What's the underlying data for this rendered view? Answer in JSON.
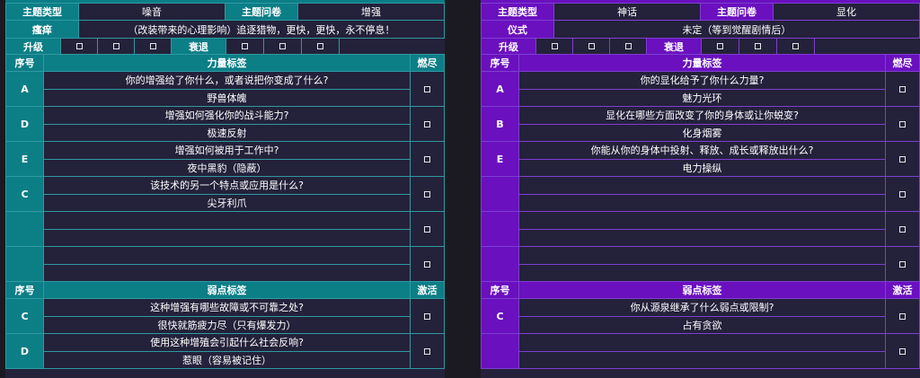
{
  "colors": {
    "left_accent": "#0c7e86",
    "right_accent": "#6a10bf",
    "background": "#1b1a22",
    "cell_bg": "#24213a"
  },
  "left": {
    "theme_type_label": "主题类型",
    "theme_type_value": "噪音",
    "theme_question_label": "主题问卷",
    "theme_question_value": "增强",
    "third_label": "瘙痒",
    "third_value": "（改装带来的心理影响）追逐猎物，更快，更快，永不停息！",
    "upgrade_label": "升级",
    "decline_label": "衰退",
    "power_section": {
      "col_id": "序号",
      "col_tag": "力量标签",
      "col_state": "燃尽"
    },
    "power_entries": [
      {
        "letter": "A",
        "question": "你的增强给了你什么，或者说把你变成了什么?",
        "answer": "野兽体魄"
      },
      {
        "letter": "D",
        "question": "增强如何强化你的战斗能力?",
        "answer": "极速反射"
      },
      {
        "letter": "E",
        "question": "增强如何被用于工作中?",
        "answer": "夜中黑豹（隐蔽）"
      },
      {
        "letter": "C",
        "question": "该技术的另一个特点或应用是什么?",
        "answer": "尖牙利爪"
      },
      {
        "letter": "",
        "question": "",
        "answer": ""
      },
      {
        "letter": "",
        "question": "",
        "answer": ""
      }
    ],
    "weak_section": {
      "col_id": "序号",
      "col_tag": "弱点标签",
      "col_state": "激活"
    },
    "weak_entries": [
      {
        "letter": "C",
        "question": "这种增强有哪些故障或不可靠之处?",
        "answer": "很快就筋疲力尽（只有爆发力）"
      },
      {
        "letter": "D",
        "question": "使用这种增殖会引起什么社会反响?",
        "answer": "惹眼（容易被记住）"
      }
    ]
  },
  "right": {
    "theme_type_label": "主题类型",
    "theme_type_value": "神话",
    "theme_question_label": "主题问卷",
    "theme_question_value": "显化",
    "third_label": "仪式",
    "third_value": "未定（等到觉醒剧情后）",
    "upgrade_label": "升级",
    "decline_label": "衰退",
    "power_section": {
      "col_id": "序号",
      "col_tag": "力量标签",
      "col_state": "燃尽"
    },
    "power_entries": [
      {
        "letter": "A",
        "question": "你的显化给予了你什么力量?",
        "answer": "魅力光环"
      },
      {
        "letter": "B",
        "question": "显化在哪些方面改变了你的身体或让你蜕变?",
        "answer": "化身烟雾"
      },
      {
        "letter": "E",
        "question": "你能从你的身体中投射、释放、成长或释放出什么?",
        "answer": "电力操纵"
      },
      {
        "letter": "",
        "question": "",
        "answer": ""
      },
      {
        "letter": "",
        "question": "",
        "answer": ""
      },
      {
        "letter": "",
        "question": "",
        "answer": ""
      }
    ],
    "weak_section": {
      "col_id": "序号",
      "col_tag": "弱点标签",
      "col_state": "激活"
    },
    "weak_entries": [
      {
        "letter": "C",
        "question": "你从源泉继承了什么弱点或限制?",
        "answer": "占有贪欲"
      },
      {
        "letter": "",
        "question": "",
        "answer": ""
      }
    ]
  }
}
